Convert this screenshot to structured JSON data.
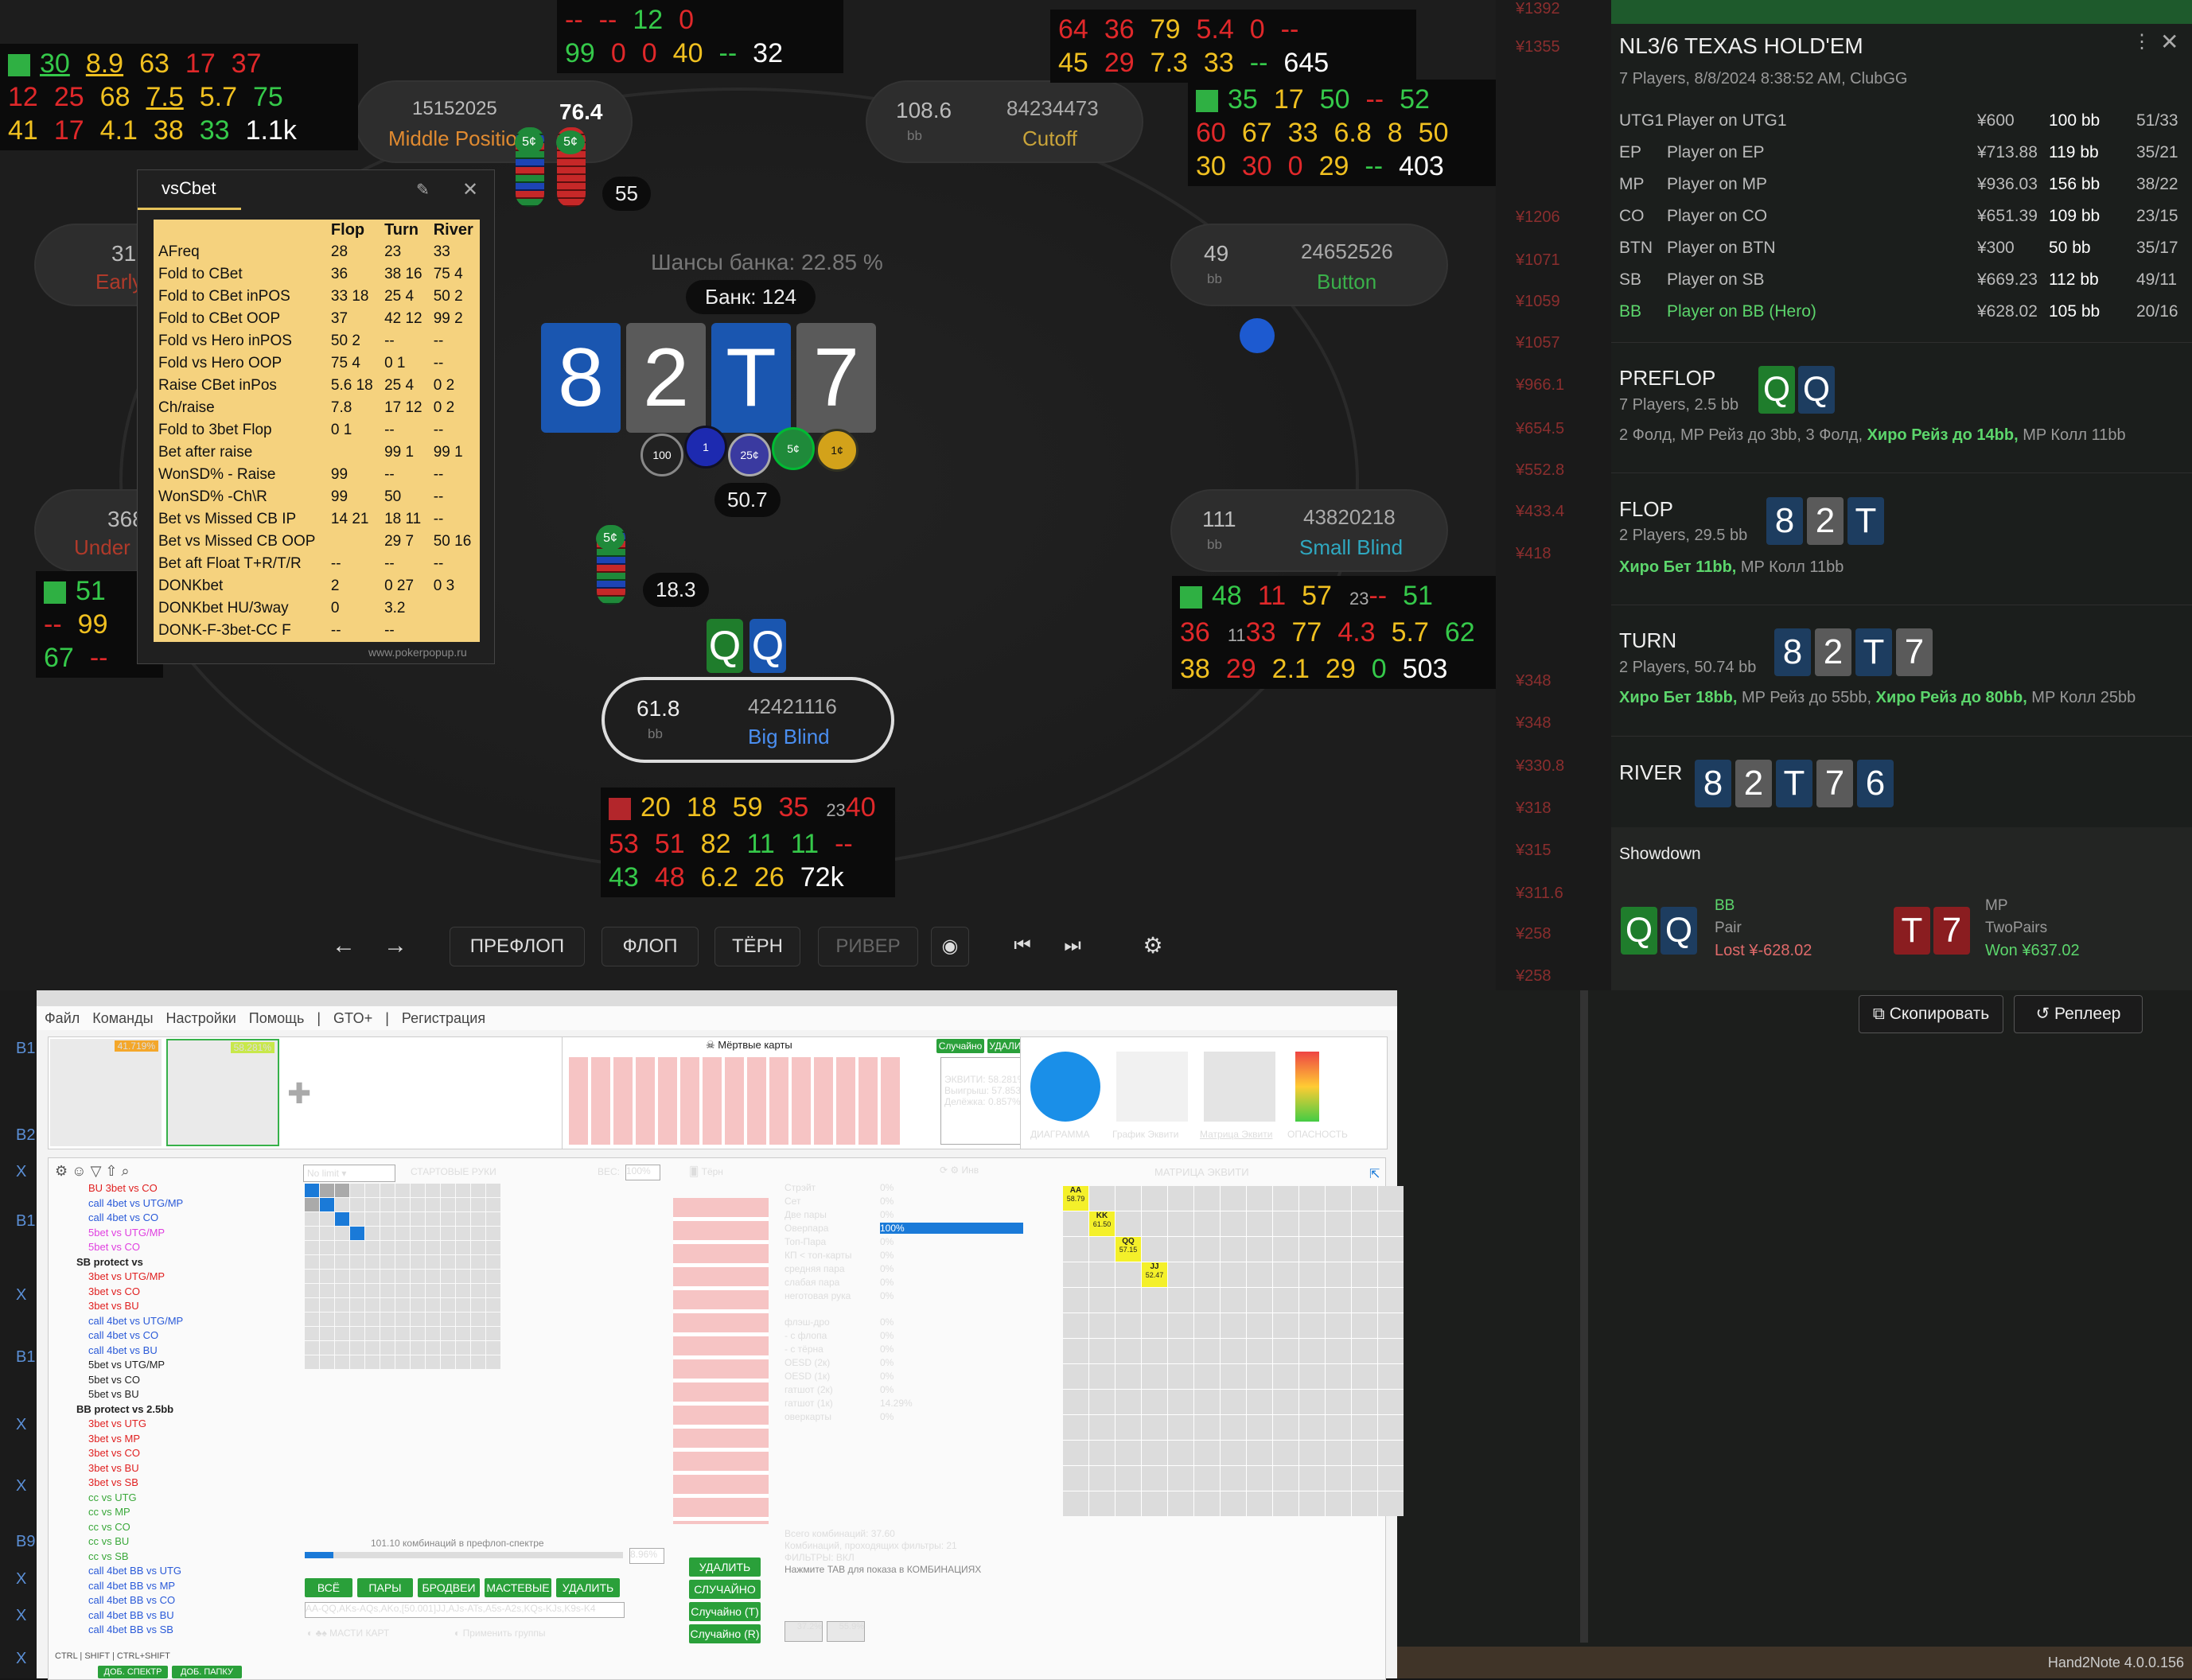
{
  "table": {
    "pot_odds": "Шансы банка: 22.85 %",
    "pot": "Банк: 124",
    "board": [
      "8",
      "2",
      "T",
      "7"
    ],
    "pot_chips_value": "50.7",
    "bet_left": "18.3",
    "bet_top": "55",
    "hero_cards": [
      "Q",
      "Q"
    ],
    "seats": [
      {
        "stack": "76.4",
        "pid": "15152025",
        "pos": "Middle Position",
        "bb": ""
      },
      {
        "stack": "108.6",
        "pid": "84234473",
        "pos": "Cutoff",
        "bb": "bb"
      },
      {
        "stack": "49",
        "pid": "24652526",
        "pos": "Button",
        "bb": "bb"
      },
      {
        "stack": "111",
        "pid": "43820218",
        "pos": "Small Blind",
        "bb": "bb"
      },
      {
        "stack": "61.8",
        "pid": "42421116",
        "pos": "Big Blind",
        "bb": "bb"
      },
      {
        "stack": "310",
        "pid": "",
        "pos": "Early",
        "bb": ""
      },
      {
        "stack": "368",
        "pid": "",
        "pos": "Under",
        "bb": ""
      }
    ],
    "chip_labels": [
      "100",
      "1",
      "25¢",
      "5¢",
      "1¢",
      "5¢",
      "5¢",
      "5¢"
    ],
    "nav": {
      "preflop": "ПРЕФЛОП",
      "flop": "ФЛОП",
      "turn": "ТЁРН",
      "river": "РИВЕР"
    },
    "hud_hero": [
      [
        "20",
        "18",
        "59",
        "35",
        "23",
        "40"
      ],
      [
        "53",
        "51",
        "82",
        "11",
        "11",
        "--"
      ],
      [
        "43",
        "48",
        "6.2",
        "26",
        "72k"
      ]
    ],
    "hud_sb": [
      [
        "48",
        "11",
        "57",
        "23",
        "--",
        "51"
      ],
      [
        "36",
        "11",
        "33",
        "6",
        "77",
        "13",
        "4.3",
        "5.7",
        "62",
        "8"
      ],
      [
        "38",
        "29",
        "7",
        "2.1",
        "29",
        "0",
        "4",
        "503"
      ]
    ],
    "hud_co": [
      [
        "35",
        "17",
        "50",
        "--",
        "52",
        "25"
      ],
      [
        "60",
        "5",
        "67",
        "3",
        "33",
        "6",
        "6.8",
        "8",
        "25",
        "50",
        "4"
      ],
      [
        "30",
        "30",
        "30",
        "10",
        "0",
        "29",
        "--",
        "403"
      ]
    ],
    "hud_top": [
      [
        "64",
        "11",
        "36",
        "14",
        "79",
        "14",
        "5.4",
        "0",
        "--"
      ],
      [
        "45",
        "29",
        "7",
        "7.3",
        "33",
        "--",
        "645"
      ]
    ],
    "hud_topleft": [
      [
        "30",
        "8.9",
        "63",
        "17",
        "6",
        "37"
      ],
      [
        "12",
        "8",
        "25",
        "8",
        "68",
        "25",
        "7.5",
        "5.7",
        "75",
        "4"
      ],
      [
        "41",
        "17",
        "24",
        "4.1",
        "38",
        "33",
        "3",
        "1.1k"
      ]
    ],
    "hud_topmid": [
      [
        "--",
        "--",
        "12",
        "8",
        "0",
        "2"
      ],
      [
        "99",
        "2",
        "0",
        "1",
        "0",
        "40",
        "--",
        "32"
      ]
    ],
    "hud_left": [
      [
        "51"
      ],
      [
        "--",
        "99"
      ],
      [
        "67",
        "3",
        "--"
      ]
    ]
  },
  "popup": {
    "title": "vsCbet",
    "headers": [
      "",
      "Flop",
      "Turn",
      "River"
    ],
    "rows": [
      [
        "AFreq",
        "28",
        "23",
        "33"
      ],
      [
        "Fold to CBet",
        "36",
        "38 16",
        "75 4"
      ],
      [
        "Fold to CBet inPOS",
        "33 18",
        "25 4",
        "50 2"
      ],
      [
        "Fold to CBet OOP",
        "37",
        "42 12",
        "99 2"
      ],
      [
        "Fold vs Hero inPOS",
        "50 2",
        "--",
        "--"
      ],
      [
        "Fold vs Hero OOP",
        "75 4",
        "0 1",
        "--"
      ],
      [
        "Raise CBet inPos",
        "5.6 18",
        "25 4",
        "0 2"
      ],
      [
        "Ch/raise",
        "7.8",
        "17 12",
        "0 2"
      ],
      [
        "Fold to 3bet Flop",
        "0 1",
        "--",
        "--"
      ],
      [
        "Bet after raise",
        "",
        "99 1",
        "99 1"
      ],
      [
        "WonSD% - Raise",
        "99",
        "--",
        "--"
      ],
      [
        "WonSD% -Ch\\R",
        "99",
        "50",
        "--"
      ],
      [
        "Bet vs Missed CB IP",
        "14 21",
        "18 11",
        "--"
      ],
      [
        "Bet vs Missed CB OOP",
        "",
        "29 7",
        "50 16"
      ],
      [
        "Bet aft Float T+R/T/R",
        "--",
        "--",
        "--"
      ],
      [
        "DONKbet",
        "2",
        "0 27",
        "0 3"
      ],
      [
        "DONKbet HU/3way",
        "0",
        "3.2",
        ""
      ],
      [
        "DONK-F-3bet-CC F",
        "--",
        "--",
        ""
      ]
    ],
    "footer": "www.pokerpopup.ru"
  },
  "history": [
    "¥1392",
    "¥1355",
    "¥1206",
    "¥1071",
    "¥1059",
    "¥1057",
    "¥966.1",
    "¥654.5",
    "¥552.8",
    "¥433.4",
    "¥418",
    "¥348",
    "¥348",
    "¥330.8",
    "¥318",
    "¥315",
    "¥311.6",
    "¥258",
    "¥258"
  ],
  "replay": {
    "title": "NL3/6 TEXAS HOLD'EM",
    "sub": "7 Players, 8/8/2024 8:38:52 AM, ClubGG",
    "players": [
      {
        "pos": "UTG1",
        "name": "Player on UTG1",
        "amt": "¥600",
        "bb": "100 bb",
        "stat": "51/33"
      },
      {
        "pos": "EP",
        "name": "Player on EP",
        "amt": "¥713.88",
        "bb": "119 bb",
        "stat": "35/21"
      },
      {
        "pos": "MP",
        "name": "Player on MP",
        "amt": "¥936.03",
        "bb": "156 bb",
        "stat": "38/22"
      },
      {
        "pos": "CO",
        "name": "Player on CO",
        "amt": "¥651.39",
        "bb": "109 bb",
        "stat": "23/15"
      },
      {
        "pos": "BTN",
        "name": "Player on BTN",
        "amt": "¥300",
        "bb": "50 bb",
        "stat": "35/17"
      },
      {
        "pos": "SB",
        "name": "Player on SB",
        "amt": "¥669.23",
        "bb": "112 bb",
        "stat": "49/11"
      },
      {
        "pos": "BB",
        "name": "Player on BB (Hero)",
        "amt": "¥628.02",
        "bb": "105 bb",
        "stat": "20/16"
      }
    ],
    "preflop": {
      "label": "PREFLOP",
      "sub": "7 Players, 2.5 bb",
      "act1": "2 Фолд, MP Рейз до 3bb, 3 Фолд, ",
      "act2": "Хиро Рейз до 14bb,",
      "act3": " MP Колл 11bb"
    },
    "flop": {
      "label": "FLOP",
      "sub": "2 Players, 29.5 bb",
      "act1": "Хиро Бет 11bb,",
      "act2": " MP Колл 11bb"
    },
    "turn": {
      "label": "TURN",
      "sub": "2 Players, 50.74 bb",
      "act1": "Хиро Бет 18bb,",
      "act2": " MP Рейз до 55bb, ",
      "act3": "Хиро Рейз до 80bb,",
      "act4": " MP Колл 25bb"
    },
    "river": {
      "label": "RIVER"
    },
    "river_cards": [
      "8",
      "2",
      "T",
      "7",
      "6"
    ],
    "showdown": "Showdown",
    "sd_bb": {
      "pos": "BB",
      "hand": "Pair",
      "result": "Lost ¥-628.02"
    },
    "sd_mp": {
      "pos": "MP",
      "hand": "TwoPairs",
      "result": "Won ¥637.02"
    },
    "copy_btn": "Скопировать",
    "replayer_btn": "Реплеер",
    "version": "Hand2Note 4.0.0.156"
  },
  "bottom": {
    "menu": [
      "Файл",
      "Команды",
      "Настройки",
      "Помощь",
      "|",
      "GTO+",
      "|",
      "Регистрация"
    ],
    "eq1": "41.719%",
    "eq2": "58.281%",
    "dead": "Мёртвые карты",
    "rnd": "Случайно",
    "del": "УДАЛИТЬ",
    "equity": "ЭКВИТИ: 58.281%",
    "wins": "Выигрыш: 57.853%",
    "split": "Делёжка: 0.857%",
    "charts": [
      "ДИАГРАММА",
      "График Эквити",
      "Матрица Эквити",
      "ОПАСНОСТЬ"
    ],
    "nolimit": "No limit",
    "start_hands": "СТАРТОВЫЕ РУКИ",
    "weight_lbl": "ВЕС:",
    "weight": "100%",
    "turn_lbl": "Тёрн",
    "inv": "Инв",
    "combos_text": "101.10 комбинаций в префлоп-спектре",
    "pct": "8.96%",
    "range_text": "AA-QQ,AKs-AQs,AKo,[50.001]JJ,AJs-ATs,A5s-A2s,KQs-KJs,K9s-K4",
    "btns": [
      "ВСЁ",
      "ПАРЫ",
      "БРОДВЕИ",
      "МАСТЕВЫЕ",
      "УДАЛИТЬ"
    ],
    "suits": "МАСТИ КАРТ",
    "apply_groups": "Применить группы",
    "del2": "УДАЛИТЬ",
    "rnd2": "СЛУЧАЙНО",
    "rnd_t": "Случайно (T)",
    "rnd_r": "Случайно (R)",
    "filters": [
      [
        "Стрэйт",
        "0%"
      ],
      [
        "Сет",
        "0%"
      ],
      [
        "Две пары",
        "0%"
      ],
      [
        "Оверпара",
        "100%"
      ],
      [
        "Топ-Пара",
        "0%"
      ],
      [
        "КП < топ-карты",
        "0%"
      ],
      [
        "средняя пара",
        "0%"
      ],
      [
        "слабая пара",
        "0%"
      ],
      [
        "неготовая рука",
        "0%"
      ],
      [
        "флэш-дро",
        "0%"
      ],
      [
        "- с флопа",
        "0%"
      ],
      [
        "- с тёрна",
        "0%"
      ],
      [
        "OESD (2к)",
        "0%"
      ],
      [
        "OESD (1к)",
        "0%"
      ],
      [
        "гатшот (2к)",
        "0%"
      ],
      [
        "гатшот (1к)",
        "14.29%"
      ],
      [
        "оверкарты",
        "0%"
      ]
    ],
    "total_combos": "Всего комбинаций: 37.60",
    "pass_combos": "Комбинаций, проходящих фильтры: 21",
    "filters_on": "ФИЛЬТРЫ: ВКЛ",
    "tab_hint": "Нажмите TAB для показа в КОМБИНАЦИЯХ",
    "f1": "37.2%",
    "f2": "55.9%",
    "matrix_title": "МАТРИЦА ЭКВИТИ",
    "matrix": [
      [
        "AA",
        "58.79"
      ],
      [
        "KK",
        "61.50"
      ],
      [
        "QQ",
        "57.15"
      ],
      [
        "JJ",
        "52.47"
      ]
    ],
    "tree": [
      [
        "BU 3bet vs CO",
        "#e02020"
      ],
      [
        "call 4bet vs UTG/MP",
        "#2a5ad8"
      ],
      [
        "call 4bet vs CO",
        "#2a5ad8"
      ],
      [
        "5bet vs UTG/MP",
        "#e040e0"
      ],
      [
        "5bet vs CO",
        "#e040e0"
      ],
      [
        "SB protect vs",
        "#222"
      ],
      [
        "3bet vs UTG/MP",
        "#e02020"
      ],
      [
        "3bet vs CO",
        "#e02020"
      ],
      [
        "3bet vs BU",
        "#e02020"
      ],
      [
        "call 4bet vs UTG/MP",
        "#2a5ad8"
      ],
      [
        "call 4bet vs CO",
        "#2a5ad8"
      ],
      [
        "call 4bet vs BU",
        "#2a5ad8"
      ],
      [
        "5bet vs UTG/MP",
        "#222"
      ],
      [
        "5bet vs CO",
        "#222"
      ],
      [
        "5bet vs BU",
        "#222"
      ],
      [
        "BB protect vs 2.5bb",
        "#222"
      ],
      [
        "3bet vs UTG",
        "#e02020"
      ],
      [
        "3bet vs MP",
        "#e02020"
      ],
      [
        "3bet vs CO",
        "#e02020"
      ],
      [
        "3bet vs BU",
        "#e02020"
      ],
      [
        "3bet vs SB",
        "#e02020"
      ],
      [
        "cc vs UTG",
        "#3aa83a"
      ],
      [
        "cc vs MP",
        "#3aa83a"
      ],
      [
        "cc vs CO",
        "#3aa83a"
      ],
      [
        "cc vs BU",
        "#3aa83a"
      ],
      [
        "cc vs SB",
        "#3aa83a"
      ],
      [
        "call 4bet BB vs UTG",
        "#2a5ad8"
      ],
      [
        "call 4bet BB vs MP",
        "#2a5ad8"
      ],
      [
        "call 4bet BB vs CO",
        "#2a5ad8"
      ],
      [
        "call 4bet BB vs BU",
        "#2a5ad8"
      ],
      [
        "call 4bet BB vs SB",
        "#2a5ad8"
      ]
    ],
    "kb": [
      "CTRL",
      "SHIFT",
      "CTRL+SHIFT"
    ],
    "add_spectr": "ДОБ. СПЕКТР",
    "add_folder": "ДОБ. ПАПКУ"
  },
  "left_strip": [
    "B1",
    "B2",
    "X",
    "B1",
    "X",
    "B1",
    "X",
    "X",
    "B9",
    "X",
    "X",
    "X"
  ]
}
